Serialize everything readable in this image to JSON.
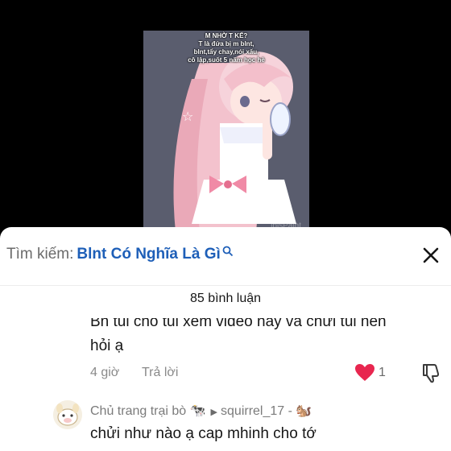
{
  "video": {
    "caption_lines": [
      "M NHỜ T KỂ?",
      "T là đứa bị m blnt,",
      "blnt,tẩy chay,nói xấu,",
      "cô lập,suốt 5 năm học hè"
    ],
    "watermark": "ibisPaint"
  },
  "search": {
    "prefix": "Tìm kiếm:",
    "term": "Blnt Có Nghĩa Là Gì"
  },
  "comments_header": {
    "count_label": "85 bình luận"
  },
  "comment1": {
    "line1": "Bn tui cho tui xem video này và chửi tui nên",
    "line2": "hỏi ạ",
    "time": "4 giờ",
    "reply_label": "Trả lời",
    "likes": "1"
  },
  "comment2": {
    "author": "Chủ trang trại bò 🐄",
    "reply_to": "squirrel_17 - 🐿️",
    "text": "chửi như nào ạ cap mhinh cho tớ"
  },
  "colors": {
    "accent": "#1e5fb8",
    "like": "#e8264f"
  }
}
